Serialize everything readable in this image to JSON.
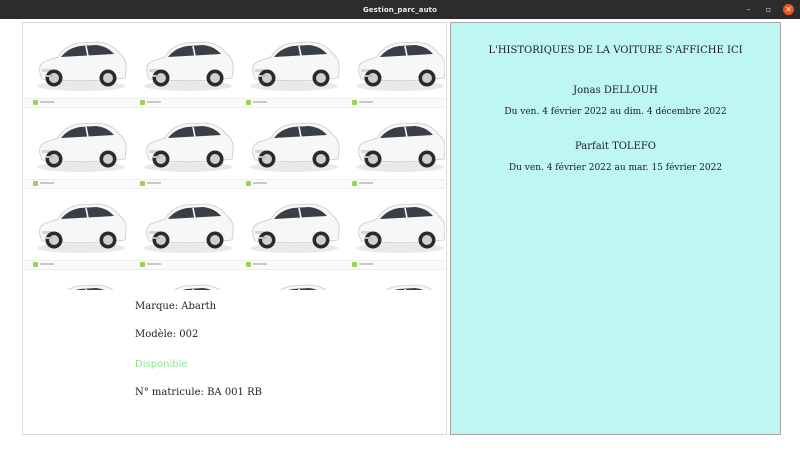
{
  "window": {
    "title": "Gestion_parc_auto",
    "controls": {
      "minimize": "–",
      "maximize": "▫",
      "close": "✕"
    }
  },
  "car": {
    "image": "white-fiat-500-photo",
    "marque": "Marque: Abarth",
    "modele": "Modèle: 002",
    "status": "Disponible",
    "matricule": "N° matricule: BA 001 RB",
    "status_color": "#8fe38f"
  },
  "history": {
    "title": "L'HISTORIQUES DE LA VOITURE S'AFFICHE ICI",
    "background": "#bdf6f3",
    "entries": [
      {
        "name": "Jonas  DELLOUH",
        "range": "Du  ven. 4 février 2022    au     dim. 4 décembre 2022"
      },
      {
        "name": "Parfait  TOLEFO",
        "range": "Du  ven. 4 février 2022    au     mar. 15 février 2022"
      }
    ]
  }
}
